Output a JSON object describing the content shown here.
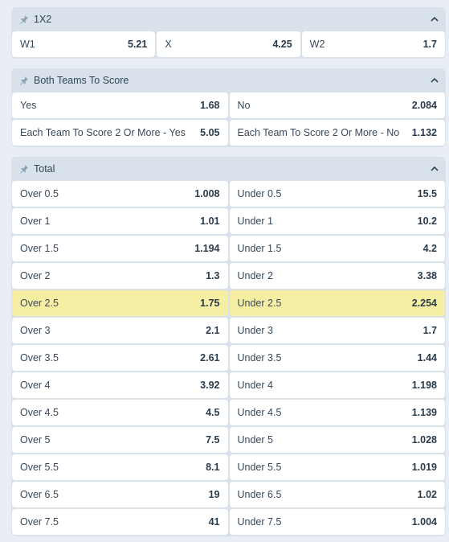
{
  "markets": [
    {
      "title": "1X2",
      "rows": [
        [
          {
            "label": "W1",
            "value": "5.21"
          },
          {
            "label": "X",
            "value": "4.25"
          },
          {
            "label": "W2",
            "value": "1.7"
          }
        ]
      ]
    },
    {
      "title": "Both Teams To Score",
      "rows": [
        [
          {
            "label": "Yes",
            "value": "1.68"
          },
          {
            "label": "No",
            "value": "2.084"
          }
        ],
        [
          {
            "label": "Each Team To Score 2 Or More - Yes",
            "value": "5.05"
          },
          {
            "label": "Each Team To Score 2 Or More - No",
            "value": "1.132"
          }
        ]
      ]
    },
    {
      "title": "Total",
      "rows": [
        [
          {
            "label": "Over 0.5",
            "value": "1.008"
          },
          {
            "label": "Under 0.5",
            "value": "15.5"
          }
        ],
        [
          {
            "label": "Over 1",
            "value": "1.01"
          },
          {
            "label": "Under 1",
            "value": "10.2"
          }
        ],
        [
          {
            "label": "Over 1.5",
            "value": "1.194"
          },
          {
            "label": "Under 1.5",
            "value": "4.2"
          }
        ],
        [
          {
            "label": "Over 2",
            "value": "1.3"
          },
          {
            "label": "Under 2",
            "value": "3.38"
          }
        ],
        [
          {
            "label": "Over 2.5",
            "value": "1.75",
            "highlight": true
          },
          {
            "label": "Under 2.5",
            "value": "2.254",
            "highlight": true
          }
        ],
        [
          {
            "label": "Over 3",
            "value": "2.1"
          },
          {
            "label": "Under 3",
            "value": "1.7"
          }
        ],
        [
          {
            "label": "Over 3.5",
            "value": "2.61"
          },
          {
            "label": "Under 3.5",
            "value": "1.44"
          }
        ],
        [
          {
            "label": "Over 4",
            "value": "3.92"
          },
          {
            "label": "Under 4",
            "value": "1.198"
          }
        ],
        [
          {
            "label": "Over 4.5",
            "value": "4.5"
          },
          {
            "label": "Under 4.5",
            "value": "1.139"
          }
        ],
        [
          {
            "label": "Over 5",
            "value": "7.5"
          },
          {
            "label": "Under 5",
            "value": "1.028"
          }
        ],
        [
          {
            "label": "Over 5.5",
            "value": "8.1"
          },
          {
            "label": "Under 5.5",
            "value": "1.019"
          }
        ],
        [
          {
            "label": "Over 6.5",
            "value": "19"
          },
          {
            "label": "Under 6.5",
            "value": "1.02"
          }
        ],
        [
          {
            "label": "Over 7.5",
            "value": "41"
          },
          {
            "label": "Under 7.5",
            "value": "1.004"
          }
        ]
      ]
    }
  ],
  "icons": {
    "pin": "pin-icon",
    "chevron": "chevron-up-icon"
  },
  "colors": {
    "highlight": "#f6eea3",
    "header": "#d9e2ea",
    "cell": "#ffffff"
  }
}
